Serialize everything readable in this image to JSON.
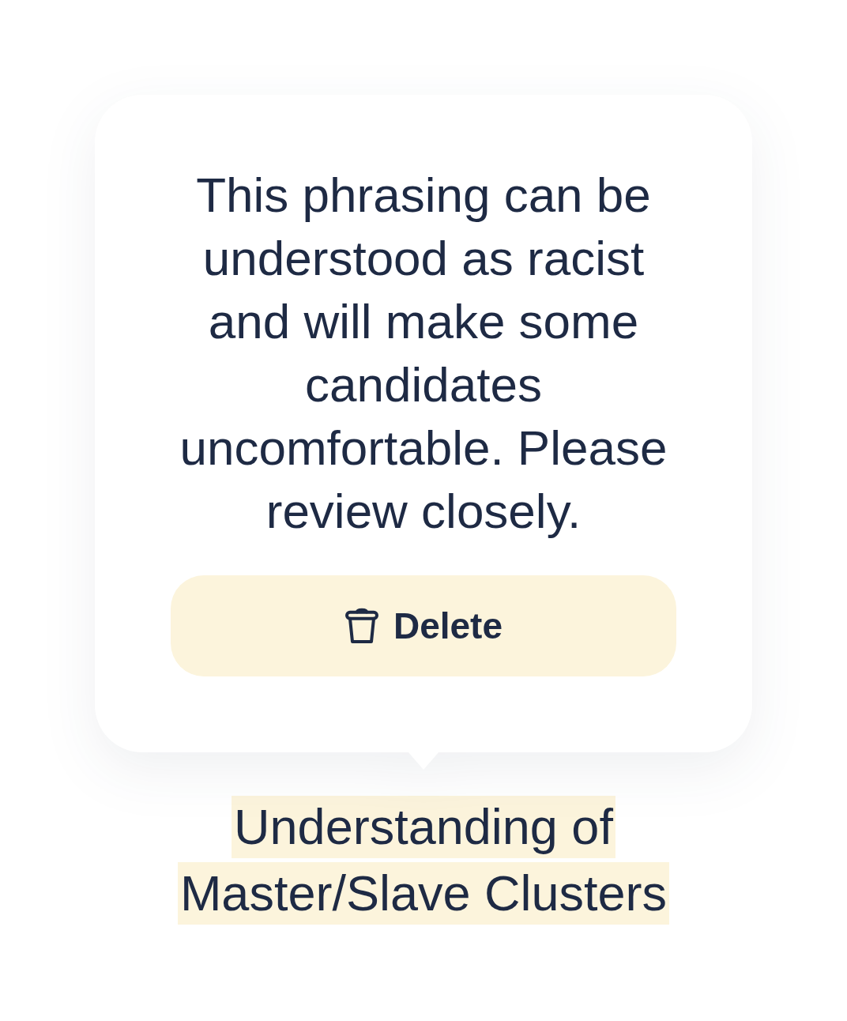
{
  "tooltip": {
    "message": "This phrasing can be understood as racist and will make some candidates uncomfortable. Please review closely.",
    "button": {
      "label": "Delete"
    }
  },
  "flagged_text": {
    "lines": [
      "Understanding of",
      "Master/Slave Clusters"
    ],
    "highlighted": true
  }
}
